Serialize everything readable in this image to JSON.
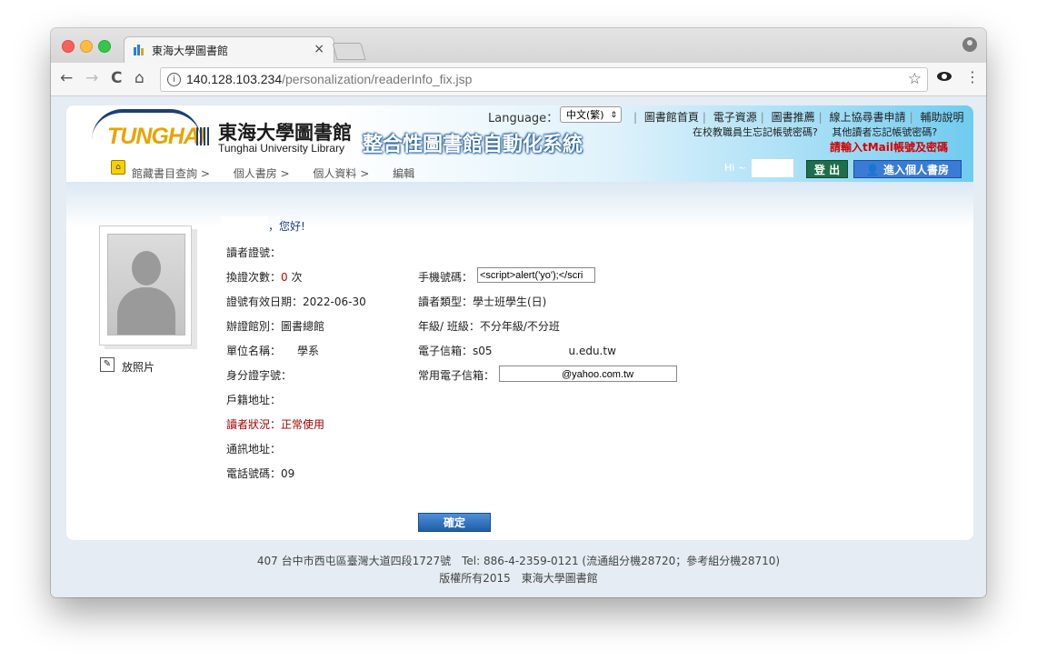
{
  "browser": {
    "tab_title": "東海大學圖書館",
    "tab_close": "×",
    "url_host": "140.128.103.234",
    "url_path": "/personalization/readerInfo_fix.jsp",
    "nav_back": "←",
    "nav_forward": "→",
    "nav_reload": "C",
    "nav_home": "⌂",
    "info_glyph": "i",
    "star_glyph": "☆",
    "menu_glyph": "⋮"
  },
  "header": {
    "logo_text": "TUNGHAI",
    "library_name_cn": "東海大學圖書館",
    "library_name_en": "Tunghai University Library",
    "system_title": "整合性圖書館自動化系統",
    "language_label": "Language：",
    "language_value": "中文(繁)",
    "language_arrow": "⇕",
    "links": [
      "圖書館首頁",
      "電子資源",
      "圖書推薦",
      "線上協尋書申請",
      "輔助說明"
    ],
    "forgot_staff": "在校教職員生忘記帳號密碼?",
    "forgot_other": "其他讀者忘記帳號密碼?",
    "warning": "請輸入tMail帳號及密碼",
    "hi_label": "Hi ~",
    "logout_label": "登 出",
    "enter_label": "進入個人書房"
  },
  "nav": {
    "items": [
      "館藏書目查詢 >",
      "個人書房 >",
      "個人資料 >",
      "編輯"
    ]
  },
  "profile": {
    "greeting": "，您好!",
    "upload_photo": "放照片",
    "card_no_label": "讀者證號：",
    "renew_label": "換證次數：",
    "renew_count": "0",
    "renew_unit": " 次",
    "expiry": "證號有效日期：2022-06-30",
    "branch": "辦證館別：圖書總館",
    "unit": "單位名稱：　　學系",
    "id_label": "身分證字號：",
    "household_addr": "戶籍地址：",
    "status": "讀者狀況：正常使用",
    "mail_addr": "通訊地址：",
    "phone": "電話號碼：09",
    "mobile_label": "手機號碼：",
    "mobile_value": "<script>alert('yo');</scri",
    "reader_type": "讀者類型：學士班學生(日)",
    "grade": "年級/ 班級：不分年級/不分班",
    "email": "電子信箱：s05　　　　　　　u.edu.tw",
    "common_email_label": "常用電子信箱：",
    "common_email_value": "@yahoo.com.tw",
    "submit_label": "確定"
  },
  "footer": {
    "line1": "407 台中市西屯區臺灣大道四段1727號　Tel: 886-4-2359-0121 (流通組分機28720；參考組分機28710)",
    "line2": "版權所有2015　東海大學圖書館"
  }
}
